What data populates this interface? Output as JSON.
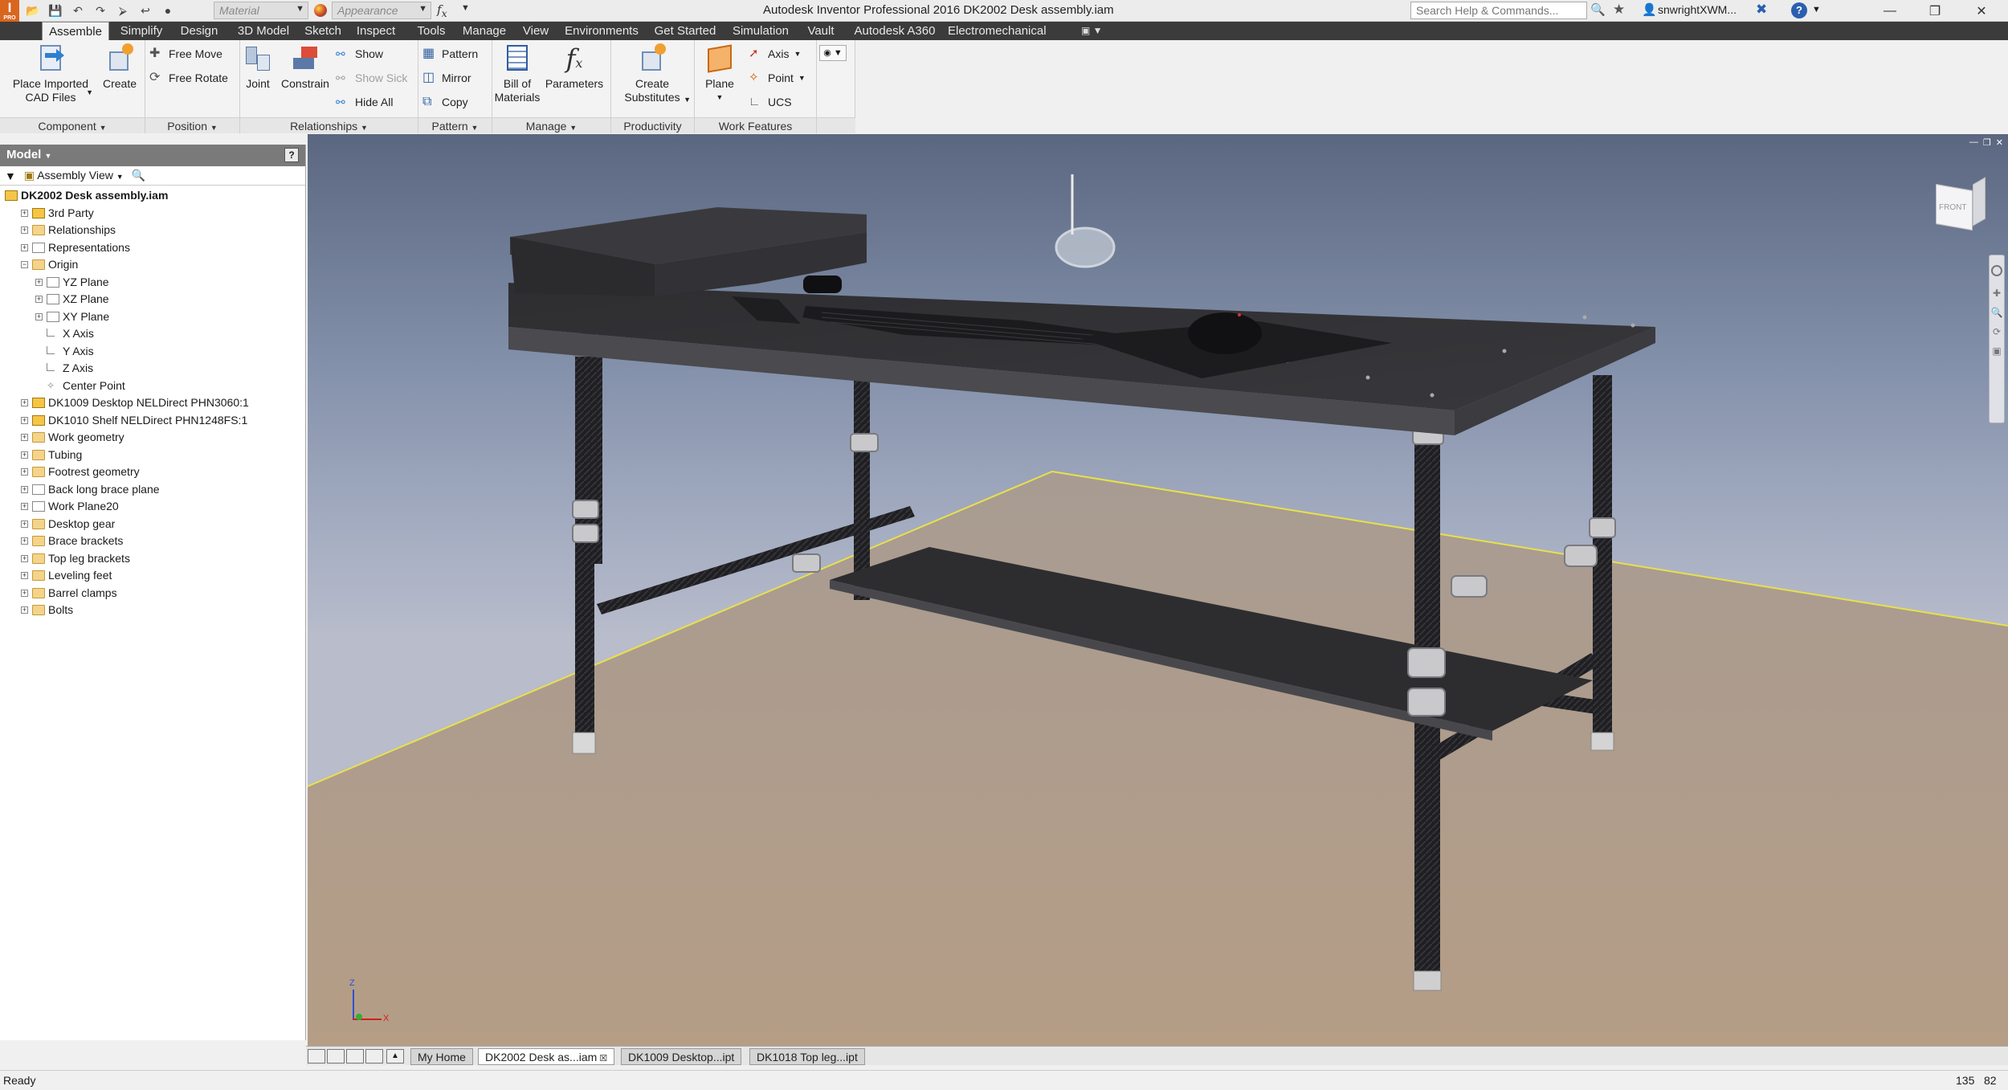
{
  "title_bar": {
    "app_title": "Autodesk Inventor Professional 2016    DK2002 Desk assembly.iam",
    "material_placeholder": "Material",
    "appearance_placeholder": "Appearance",
    "search_placeholder": "Search Help & Commands...",
    "user_name": "snwrightXWM...",
    "app_badge": "PRO"
  },
  "tabs": [
    "Assemble",
    "Simplify",
    "Design",
    "3D Model",
    "Sketch",
    "Inspect",
    "Tools",
    "Manage",
    "View",
    "Environments",
    "Get Started",
    "Simulation",
    "Vault",
    "Autodesk A360",
    "Electromechanical"
  ],
  "ribbon": {
    "place_imported": "Place Imported\nCAD Files",
    "create": "Create",
    "free_move": "Free Move",
    "free_rotate": "Free Rotate",
    "joint": "Joint",
    "constrain": "Constrain",
    "show": "Show",
    "show_sick": "Show Sick",
    "hide_all": "Hide All",
    "pattern": "Pattern",
    "mirror": "Mirror",
    "copy": "Copy",
    "bill_of_materials": "Bill of\nMaterials",
    "parameters": "Parameters",
    "create_substitutes": "Create\nSubstitutes",
    "plane": "Plane",
    "axis": "Axis",
    "point": "Point",
    "ucs": "UCS",
    "panels": {
      "component": "Component",
      "position": "Position",
      "relationships": "Relationships",
      "pattern": "Pattern",
      "manage": "Manage",
      "productivity": "Productivity",
      "work_features": "Work Features"
    }
  },
  "browser": {
    "header": "Model",
    "view_label": "Assembly View",
    "tree": [
      {
        "label": "DK2002 Desk assembly.iam",
        "level": 0,
        "type": "asm",
        "bold": true,
        "expander": ""
      },
      {
        "label": "3rd Party",
        "level": 1,
        "type": "asm2",
        "expander": "+"
      },
      {
        "label": "Relationships",
        "level": 1,
        "type": "folder",
        "expander": "+"
      },
      {
        "label": "Representations",
        "level": 1,
        "type": "plane",
        "expander": "+"
      },
      {
        "label": "Origin",
        "level": 1,
        "type": "folder",
        "expander": "-"
      },
      {
        "label": "YZ Plane",
        "level": 2,
        "type": "plane",
        "expander": "+"
      },
      {
        "label": "XZ Plane",
        "level": 2,
        "type": "plane",
        "expander": "+"
      },
      {
        "label": "XY Plane",
        "level": 2,
        "type": "plane",
        "expander": "+"
      },
      {
        "label": "X Axis",
        "level": 2,
        "type": "axis",
        "expander": ""
      },
      {
        "label": "Y Axis",
        "level": 2,
        "type": "axis",
        "expander": ""
      },
      {
        "label": "Z Axis",
        "level": 2,
        "type": "axis",
        "expander": ""
      },
      {
        "label": "Center Point",
        "level": 2,
        "type": "point",
        "expander": ""
      },
      {
        "label": "DK1009 Desktop NELDirect PHN3060:1",
        "level": 1,
        "type": "asm",
        "expander": "+"
      },
      {
        "label": "DK1010 Shelf NELDirect PHN1248FS:1",
        "level": 1,
        "type": "asm",
        "expander": "+"
      },
      {
        "label": "Work geometry",
        "level": 1,
        "type": "folder",
        "expander": "+"
      },
      {
        "label": "Tubing",
        "level": 1,
        "type": "folder",
        "expander": "+"
      },
      {
        "label": "Footrest geometry",
        "level": 1,
        "type": "folder",
        "expander": "+"
      },
      {
        "label": "Back long brace plane",
        "level": 1,
        "type": "plane",
        "expander": "+"
      },
      {
        "label": "Work Plane20",
        "level": 1,
        "type": "plane",
        "expander": "+"
      },
      {
        "label": "Desktop gear",
        "level": 1,
        "type": "folder",
        "expander": "+"
      },
      {
        "label": "Brace brackets",
        "level": 1,
        "type": "folder",
        "expander": "+"
      },
      {
        "label": "Top leg brackets",
        "level": 1,
        "type": "folder",
        "expander": "+"
      },
      {
        "label": "Leveling feet",
        "level": 1,
        "type": "folder",
        "expander": "+"
      },
      {
        "label": "Barrel clamps",
        "level": 1,
        "type": "folder",
        "expander": "+"
      },
      {
        "label": "Bolts",
        "level": 1,
        "type": "folder",
        "expander": "+"
      }
    ]
  },
  "viewcube": {
    "face_label": "FRONT"
  },
  "triad": {
    "z": "Z",
    "x": "X"
  },
  "doc_tabs": [
    "My Home",
    "DK2002 Desk as...iam",
    "DK1009 Desktop...ipt",
    "DK1018 Top leg...ipt"
  ],
  "status": {
    "text": "Ready",
    "coord_1": "135",
    "coord_2": "82"
  }
}
